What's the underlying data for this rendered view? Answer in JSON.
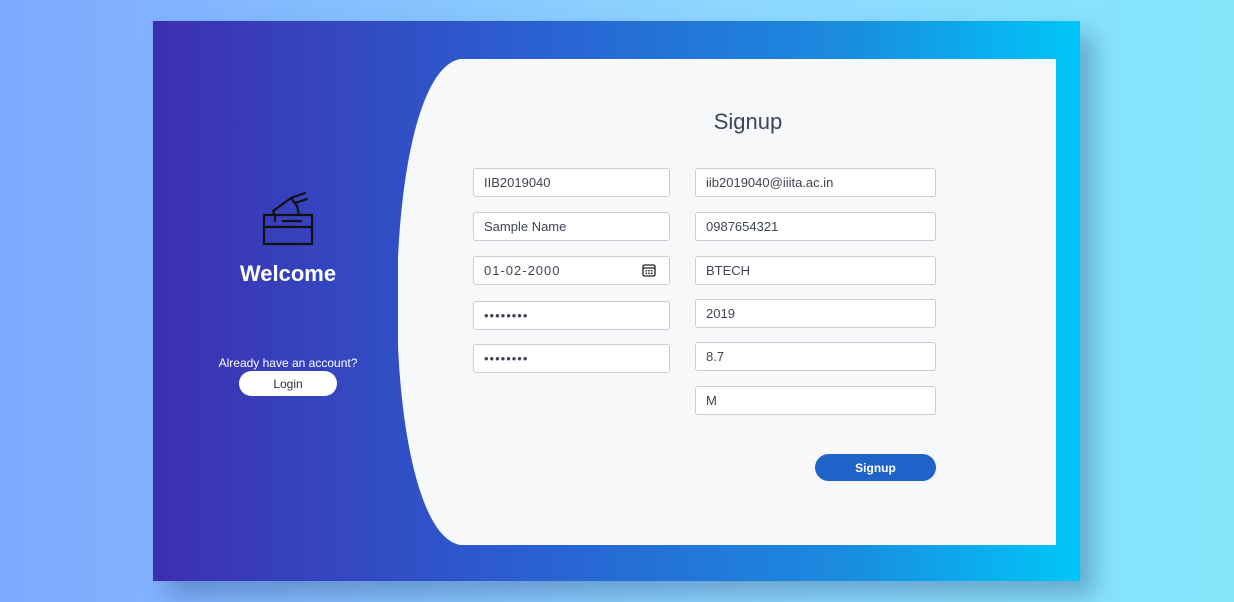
{
  "left": {
    "icon": "ballot-box-icon",
    "welcome": "Welcome",
    "already_text": "Already have an account?",
    "login_label": "Login"
  },
  "form": {
    "title": "Signup",
    "fields": {
      "roll_no": "IIB2019040",
      "name": "Sample Name",
      "dob": "01-02-2000",
      "password": "••••••••",
      "confirm_password": "••••••••",
      "email": "iib2019040@iiita.ac.in",
      "phone": "0987654321",
      "program": "BTECH",
      "batch": "2019",
      "cgpa": "8.7",
      "gender": "M"
    },
    "calendar_icon": "calendar-icon",
    "signup_label": "Signup"
  },
  "colors": {
    "card_gradient_start": "#3d2fb0",
    "card_gradient_end": "#00c6f8",
    "form_bg": "#f6f8fa",
    "signup_button": "#1f63c9"
  }
}
